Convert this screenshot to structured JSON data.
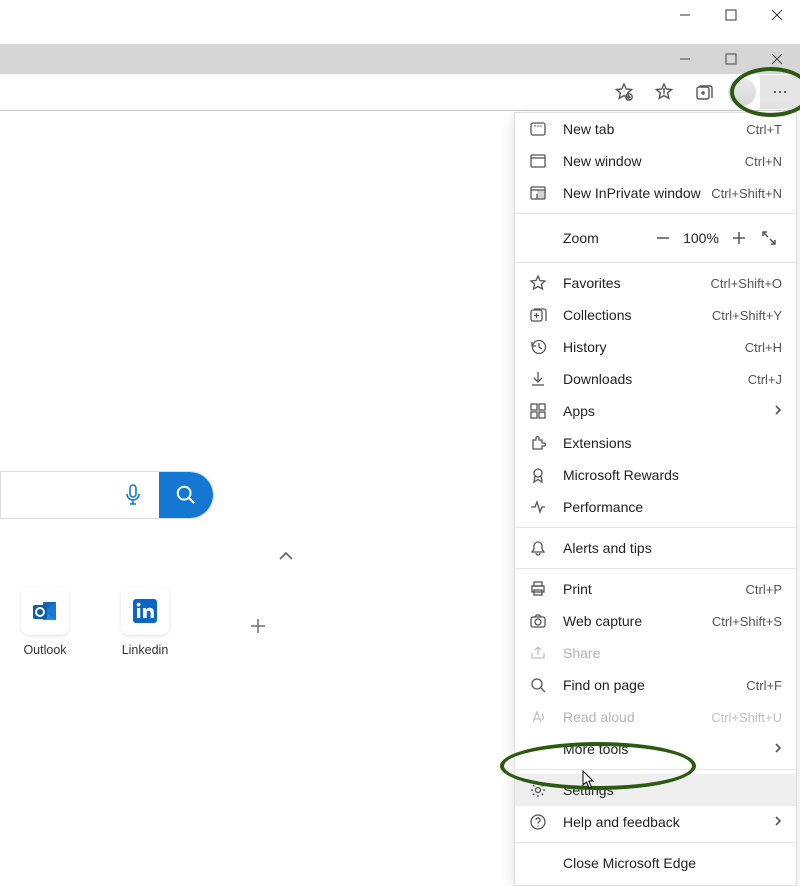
{
  "menu": {
    "new_tab": {
      "label": "New tab",
      "shortcut": "Ctrl+T"
    },
    "new_window": {
      "label": "New window",
      "shortcut": "Ctrl+N"
    },
    "new_inprivate": {
      "label": "New InPrivate window",
      "shortcut": "Ctrl+Shift+N"
    },
    "zoom_label": "Zoom",
    "zoom_value": "100%",
    "favorites": {
      "label": "Favorites",
      "shortcut": "Ctrl+Shift+O"
    },
    "collections": {
      "label": "Collections",
      "shortcut": "Ctrl+Shift+Y"
    },
    "history": {
      "label": "History",
      "shortcut": "Ctrl+H"
    },
    "downloads": {
      "label": "Downloads",
      "shortcut": "Ctrl+J"
    },
    "apps": {
      "label": "Apps"
    },
    "extensions": {
      "label": "Extensions"
    },
    "rewards": {
      "label": "Microsoft Rewards"
    },
    "performance": {
      "label": "Performance"
    },
    "alerts": {
      "label": "Alerts and tips"
    },
    "print": {
      "label": "Print",
      "shortcut": "Ctrl+P"
    },
    "web_capture": {
      "label": "Web capture",
      "shortcut": "Ctrl+Shift+S"
    },
    "share": {
      "label": "Share"
    },
    "find": {
      "label": "Find on page",
      "shortcut": "Ctrl+F"
    },
    "read_aloud": {
      "label": "Read aloud",
      "shortcut": "Ctrl+Shift+U"
    },
    "more_tools": {
      "label": "More tools"
    },
    "settings": {
      "label": "Settings"
    },
    "help": {
      "label": "Help and feedback"
    },
    "close": {
      "label": "Close Microsoft Edge"
    }
  },
  "tiles": {
    "outlook": "Outlook",
    "linkedin": "Linkedin"
  }
}
